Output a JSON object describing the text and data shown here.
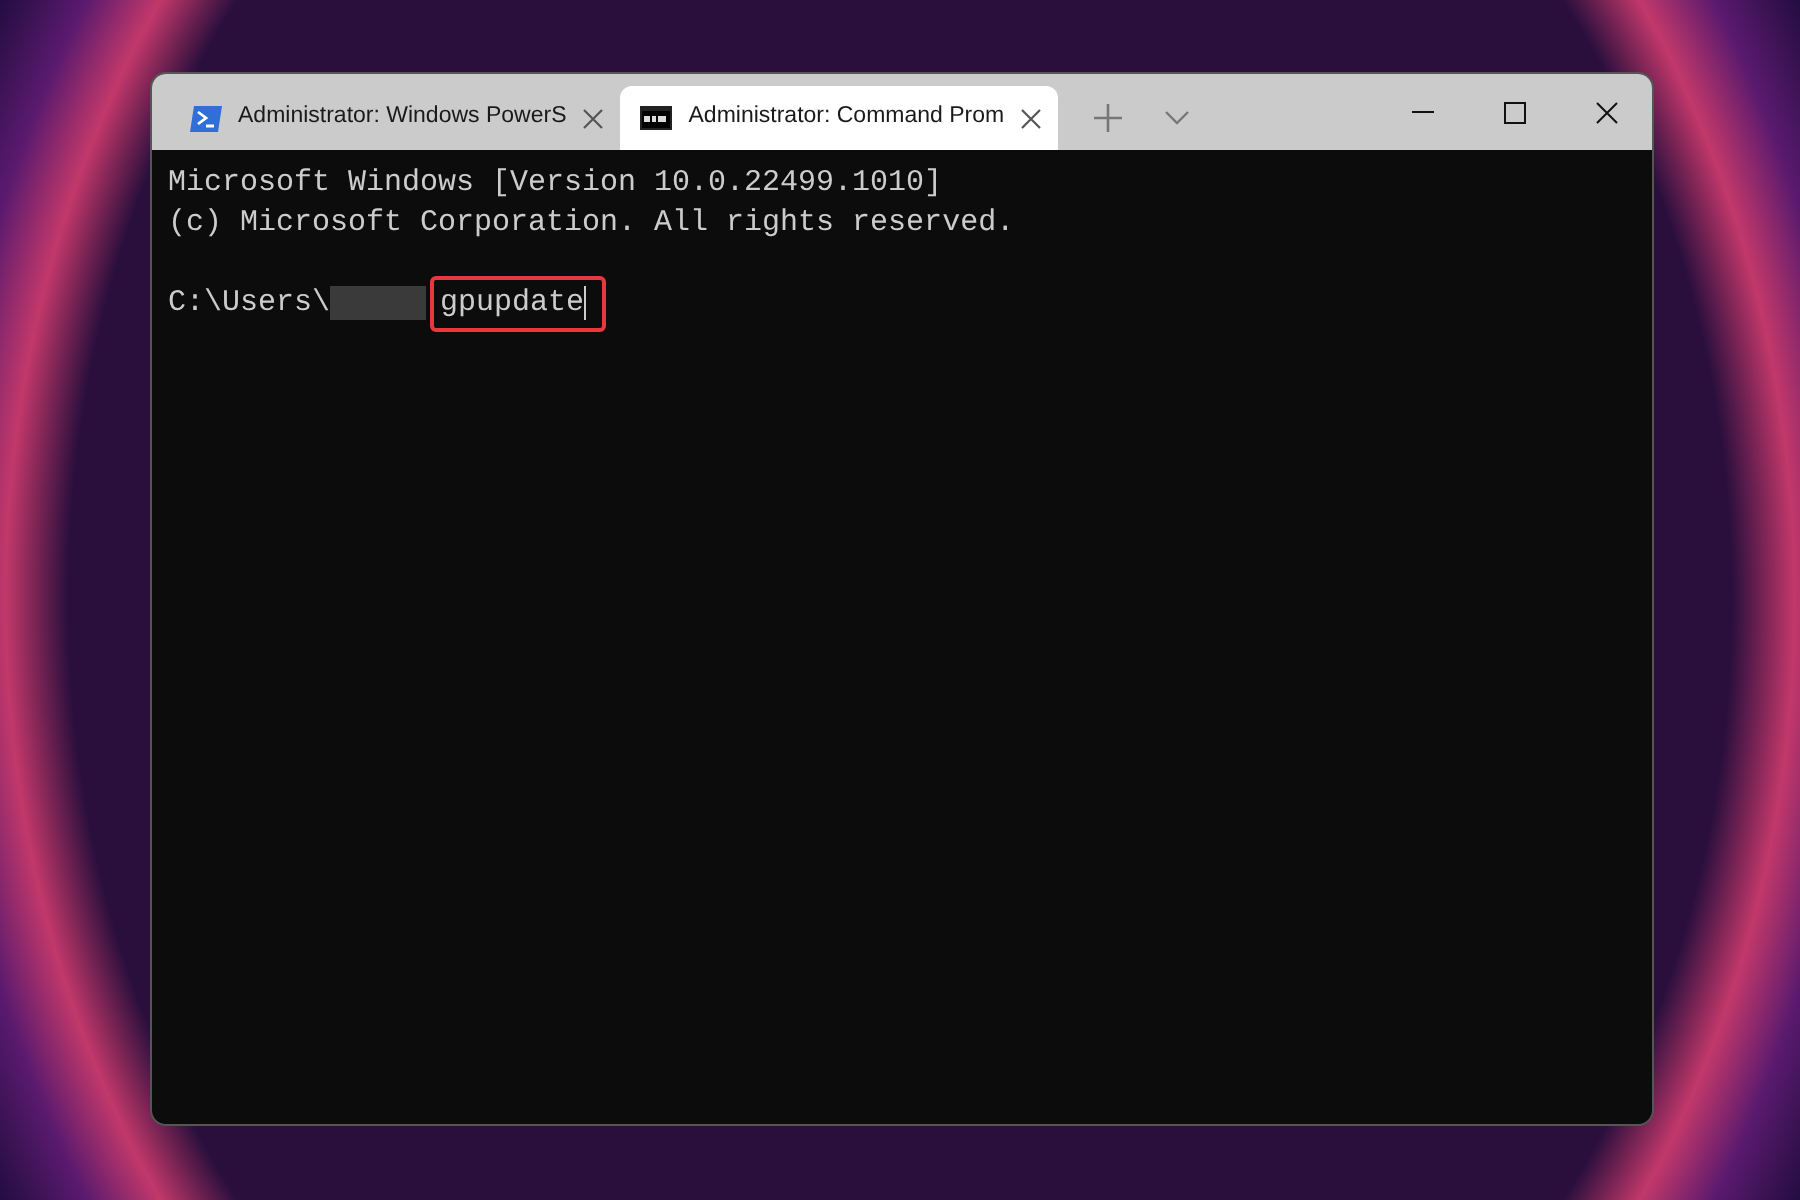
{
  "tabs": [
    {
      "title": "Administrator: Windows PowerS",
      "kind": "powershell",
      "selected": false
    },
    {
      "title": "Administrator: Command Prom",
      "kind": "cmd",
      "selected": true
    }
  ],
  "console": {
    "lines": [
      "Microsoft Windows [Version 10.0.22499.1010]",
      "(c) Microsoft Corporation. All rights reserved."
    ],
    "prompt": {
      "path": "C:\\Users\\",
      "command": "gpupdate",
      "highlighted": true
    }
  }
}
